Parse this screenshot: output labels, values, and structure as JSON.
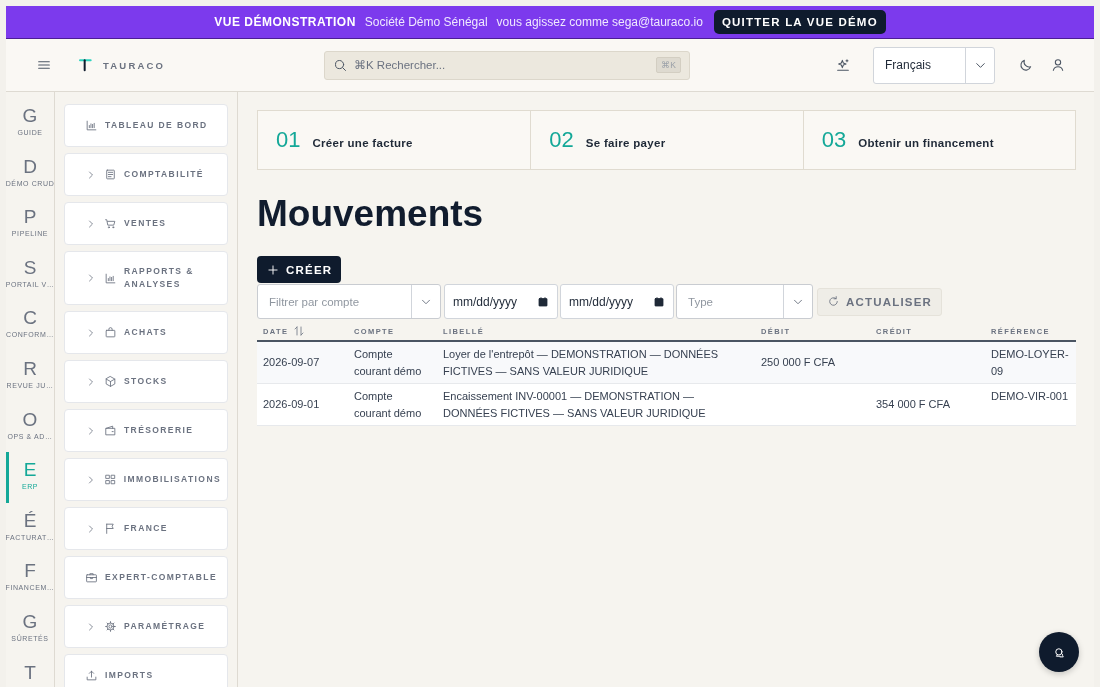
{
  "demo_banner": {
    "title": "VUE DÉMONSTRATION",
    "company": "Société Démo Sénégal",
    "acting_as": "vous agissez comme sega@tauraco.io",
    "exit_button": "QUITTER LA VUE DÉMO"
  },
  "header": {
    "brand": "TAURACO",
    "search": {
      "placeholder": "⌘K Rechercher...",
      "shortcut": "⌘K"
    },
    "language": "Français"
  },
  "rail": [
    {
      "letter": "G",
      "label": "GUIDE",
      "selected": false
    },
    {
      "letter": "D",
      "label": "DÉMO CRUD",
      "selected": false
    },
    {
      "letter": "P",
      "label": "PIPELINE",
      "selected": false
    },
    {
      "letter": "S",
      "label": "PORTAIL V…",
      "selected": false
    },
    {
      "letter": "C",
      "label": "CONFORM…",
      "selected": false
    },
    {
      "letter": "R",
      "label": "REVUE JU…",
      "selected": false
    },
    {
      "letter": "O",
      "label": "OPS & AD…",
      "selected": false
    },
    {
      "letter": "E",
      "label": "ERP",
      "selected": true
    },
    {
      "letter": "É",
      "label": "FACTURAT…",
      "selected": false
    },
    {
      "letter": "F",
      "label": "FINANCEM…",
      "selected": false
    },
    {
      "letter": "G",
      "label": "SÛRETÉS",
      "selected": false
    },
    {
      "letter": "T",
      "selected": false
    }
  ],
  "nav": [
    {
      "label": "TABLEAU DE BORD",
      "expandable": false
    },
    {
      "label": "COMPTABILITÉ",
      "expandable": true
    },
    {
      "label": "VENTES",
      "expandable": true
    },
    {
      "label": "RAPPORTS & ANALYSES",
      "expandable": true
    },
    {
      "label": "ACHATS",
      "expandable": true
    },
    {
      "label": "STOCKS",
      "expandable": true
    },
    {
      "label": "TRÉSORERIE",
      "expandable": true
    },
    {
      "label": "IMMOBILISATIONS",
      "expandable": true
    },
    {
      "label": "FRANCE",
      "expandable": true
    },
    {
      "label": "EXPERT-COMPTABLE",
      "expandable": false
    },
    {
      "label": "PARAMÉTRAGE",
      "expandable": true
    },
    {
      "label": "IMPORTS",
      "expandable": false
    }
  ],
  "steps": [
    {
      "number": "01",
      "label": "Créer une facture"
    },
    {
      "number": "02",
      "label": "Se faire payer"
    },
    {
      "number": "03",
      "label": "Obtenir un financement"
    }
  ],
  "page_title": "Mouvements",
  "create_button": "CRÉER",
  "filters": {
    "account_placeholder": "Filtrer par compte",
    "date_from": "mm/dd/yyyy",
    "date_to": "mm/dd/yyyy",
    "type_placeholder": "Type",
    "refresh_button": "ACTUALISER"
  },
  "table": {
    "columns": [
      {
        "label": "DATE",
        "sortable": true
      },
      {
        "label": "COMPTE",
        "sortable": false
      },
      {
        "label": "LIBELLÉ",
        "sortable": false
      },
      {
        "label": "DÉBIT",
        "sortable": false
      },
      {
        "label": "CRÉDIT",
        "sortable": false
      },
      {
        "label": "RÉFÉRENCE",
        "sortable": false
      }
    ],
    "rows": [
      {
        "cells": [
          "2026-09-07",
          "Compte courant démo",
          "Loyer de l'entrepôt — DEMONSTRATION — DONNÉES FICTIVES — SANS VALEUR JURIDIQUE",
          "250 000 F CFA",
          null,
          "DEMO-LOYER-09"
        ]
      },
      {
        "cells": [
          "2026-09-01",
          "Compte courant démo",
          "Encaissement INV-00001 — DEMONSTRATION — DONNÉES FICTIVES — SANS VALEUR JURIDIQUE",
          null,
          "354 000 F CFA",
          "DEMO-VIR-001"
        ]
      }
    ]
  }
}
